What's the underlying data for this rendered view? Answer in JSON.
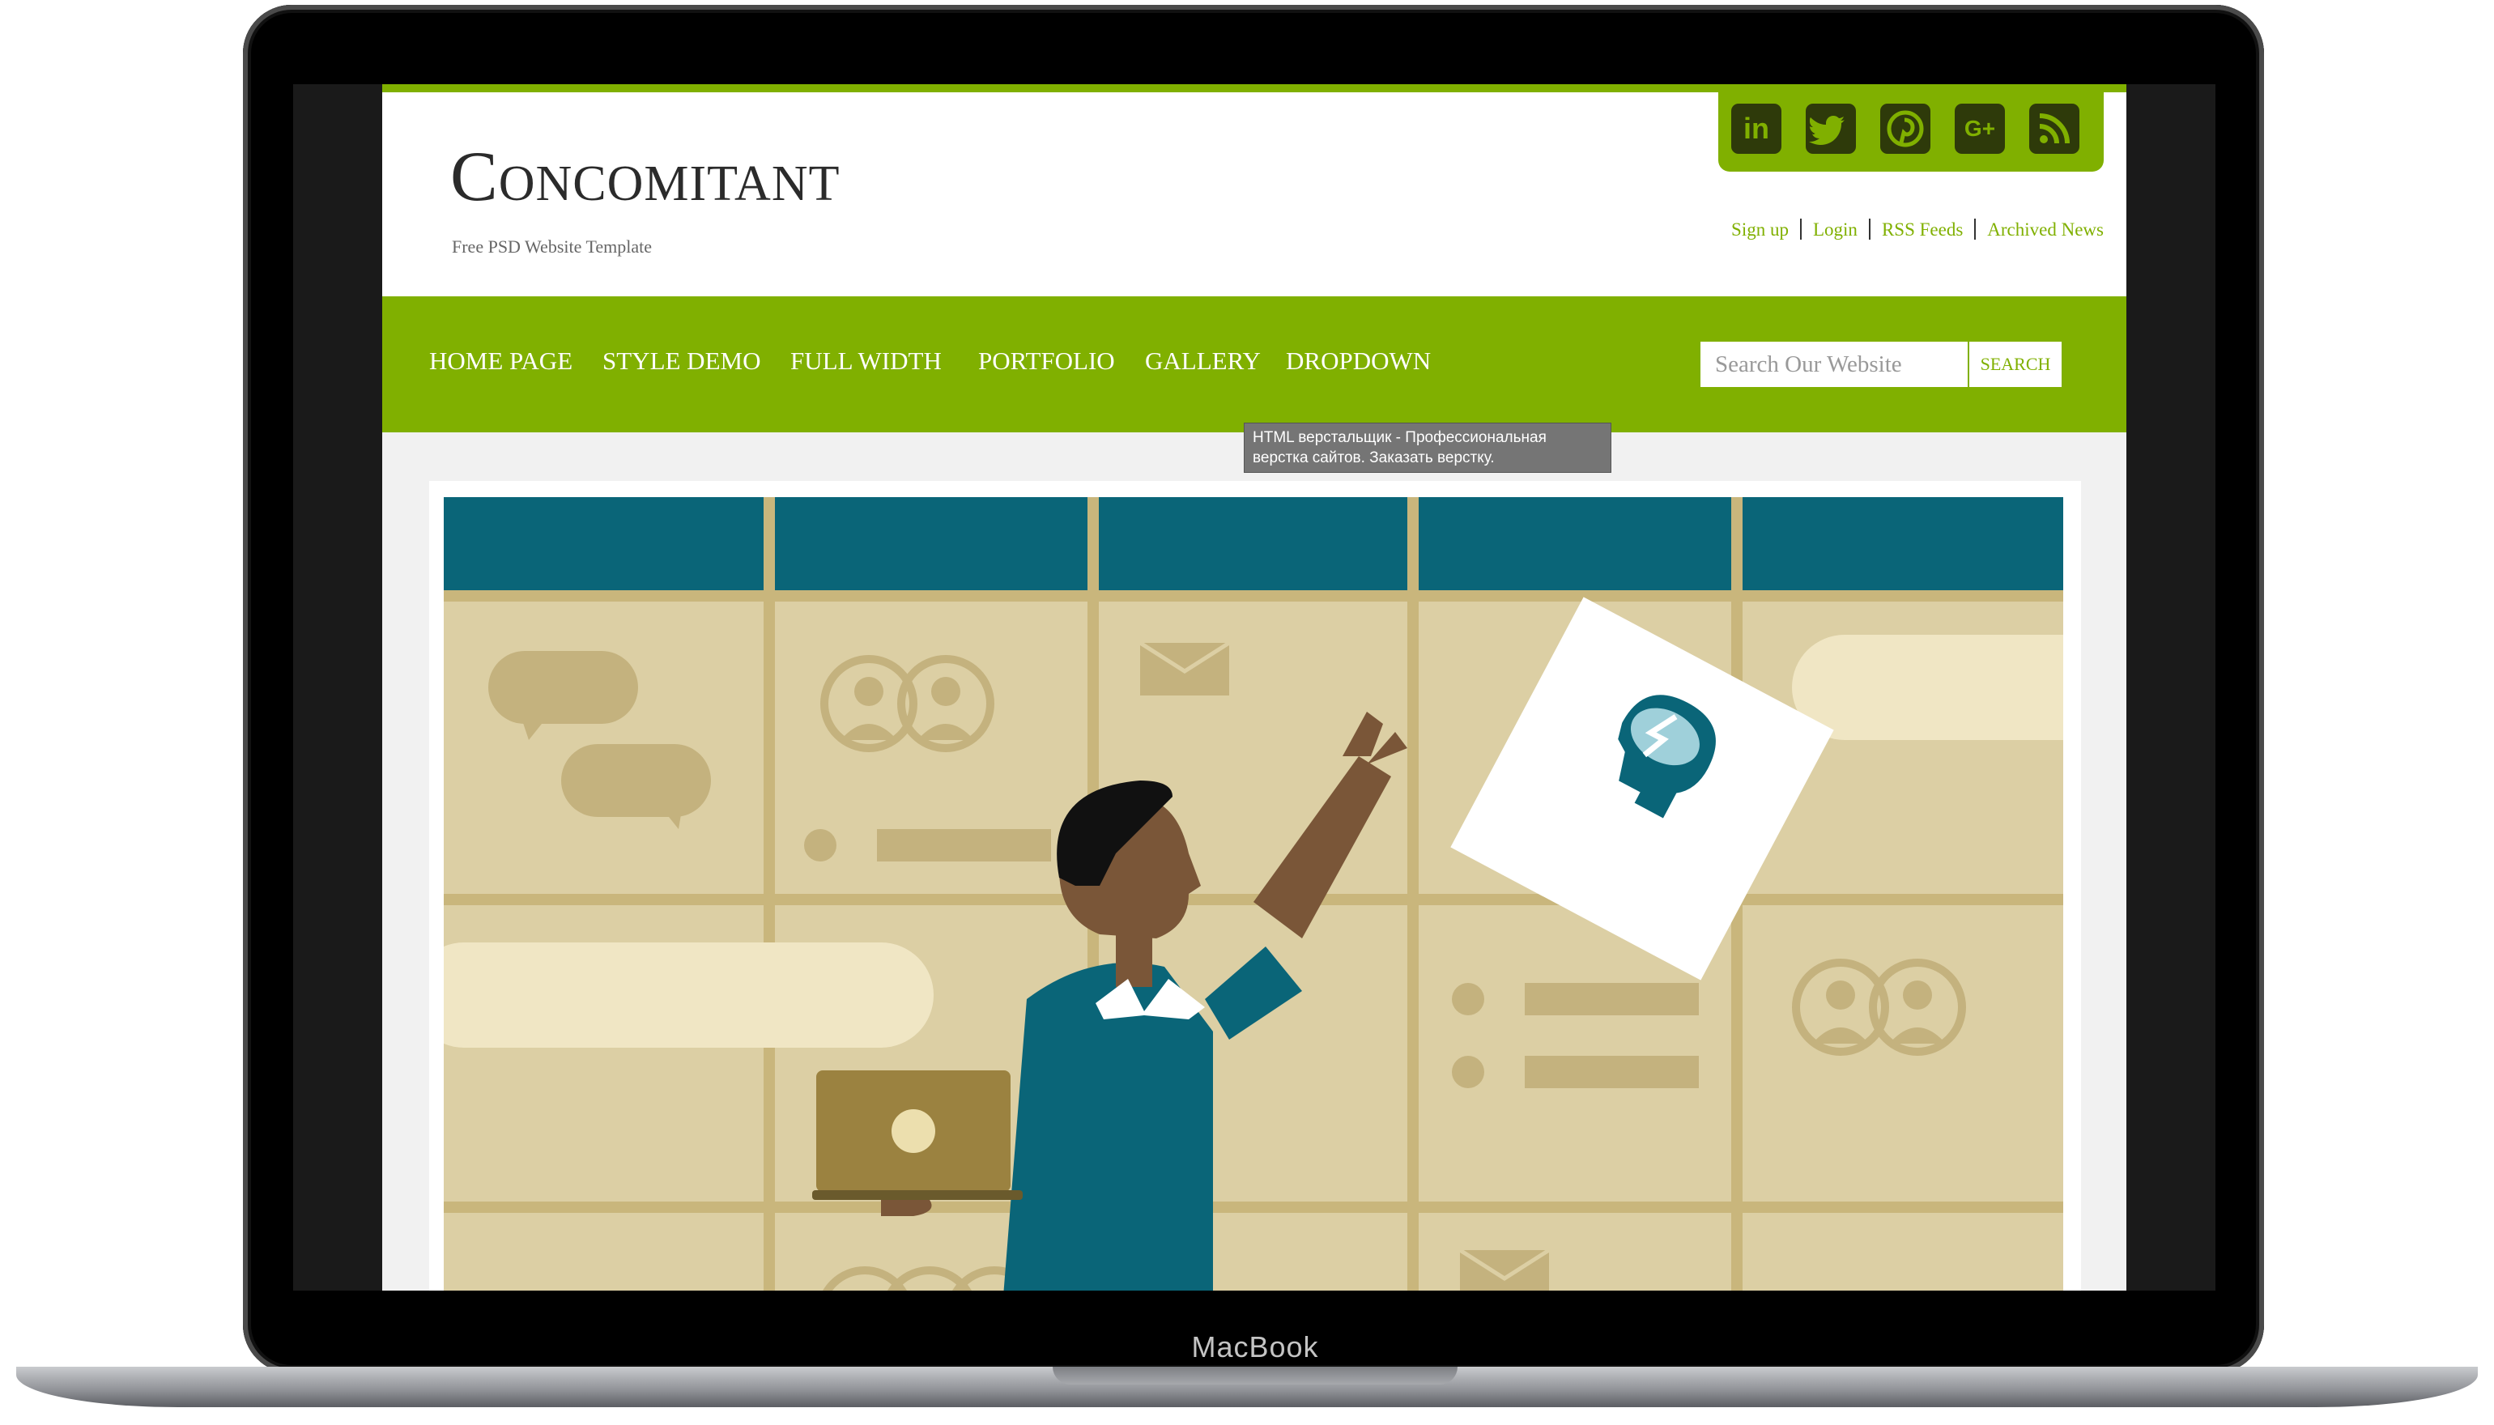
{
  "site": {
    "title": "Concomitant",
    "tagline": "Free PSD Website Template"
  },
  "social_icons": [
    "linkedin-icon",
    "twitter-icon",
    "pinterest-icon",
    "google-plus-icon",
    "rss-icon"
  ],
  "social_glyphs": [
    "in",
    "t",
    "p",
    "G+",
    "rss"
  ],
  "top_links": [
    "Sign up",
    "Login",
    "RSS Feeds",
    "Archived News"
  ],
  "nav": [
    "HOME PAGE",
    "STYLE DEMO",
    "FULL WIDTH",
    "PORTFOLIO",
    "GALLERY",
    "DROPDOWN"
  ],
  "search": {
    "placeholder": "Search Our Website",
    "button": "SEARCH"
  },
  "tooltip": {
    "line1": "HTML верстальщик - Профессиональная",
    "line2": "верстка сайтов. Заказать верстку."
  },
  "device_label": "MacBook",
  "colors": {
    "accent": "#80b000",
    "teal": "#0a6578",
    "beige": "#dccfa4"
  }
}
